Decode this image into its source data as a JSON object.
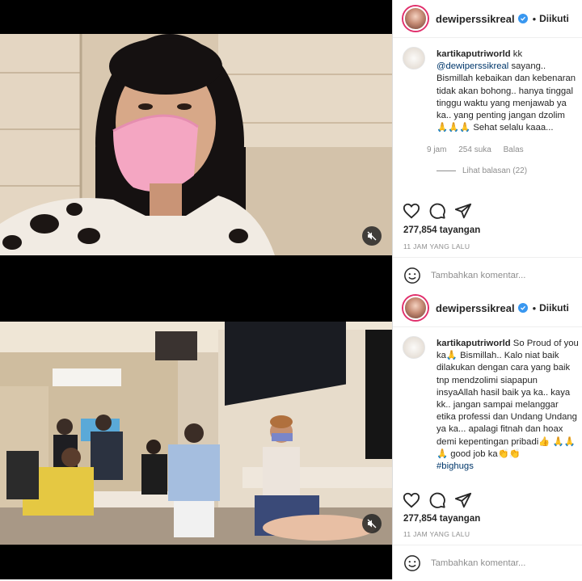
{
  "posts": [
    {
      "author": "dewiperssikreal",
      "follow_label": "Diikuti",
      "comment_author": "kartikaputriworld",
      "comment_body_1": " kk ",
      "comment_mention": "@dewiperssikreal",
      "comment_body_2": " sayang.. Bismillah kebaikan dan kebenaran tidak akan bohong.. hanya tinggal tinggu waktu yang menjawab ya ka.. yang penting jangan dzolim 🙏🙏🙏 Sehat selalu kaaa...",
      "time": "9 jam",
      "likes": "254 suka",
      "reply_label": "Balas",
      "view_replies": "Lihat balasan (22)",
      "views": "277,854 tayangan",
      "ago": "11 JAM YANG LALU",
      "add_comment": "Tambahkan komentar..."
    },
    {
      "author": "dewiperssikreal",
      "follow_label": "Diikuti",
      "comment_author": "kartikaputriworld",
      "comment_body_1": " So Proud of you ka🙏 Bismillah.. Kalo niat baik dilakukan dengan cara yang baik tnp mendzolimi siapapun insyaAllah hasil baik ya ka.. kaya kk.. jangan sampai melanggar etika professi dan Undang Undang ya ka... apalagi fitnah dan hoax demi kepentingan pribadi👍 🙏🙏🙏 good job ka👏👏",
      "comment_tag": "#bighugs",
      "views": "277,854 tayangan",
      "ago": "11 JAM YANG LALU",
      "add_comment": "Tambahkan komentar..."
    }
  ],
  "icons": {
    "verified": "verified-badge-icon",
    "mute": "speaker-muted-icon",
    "like": "heart-icon",
    "comment": "comment-bubble-icon",
    "share": "paper-plane-icon",
    "emoji": "smiley-icon"
  },
  "colors": {
    "verified": "#3897f0",
    "mention": "#00376b",
    "secondary_text": "#8e8e8e",
    "story_ring": "#e1306c"
  }
}
